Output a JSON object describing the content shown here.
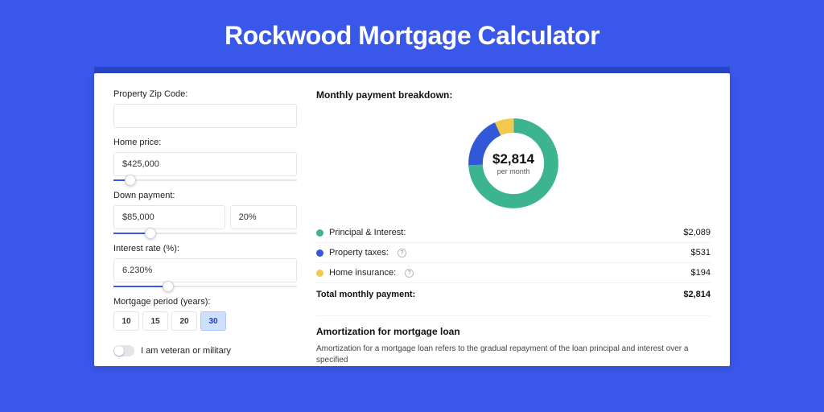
{
  "page_title": "Rockwood Mortgage Calculator",
  "colors": {
    "green": "#3cb490",
    "blue": "#3258d8",
    "yellow": "#f2c94c"
  },
  "form": {
    "zip_label": "Property Zip Code:",
    "zip_value": "",
    "home_price_label": "Home price:",
    "home_price_value": "$425,000",
    "home_price_slider_pct": 9,
    "down_payment_label": "Down payment:",
    "down_payment_value": "$85,000",
    "down_payment_pct_value": "20%",
    "down_payment_slider_pct": 20,
    "interest_label": "Interest rate (%):",
    "interest_value": "6.230%",
    "interest_slider_pct": 30,
    "period_label": "Mortgage period (years):",
    "periods": [
      "10",
      "15",
      "20",
      "30"
    ],
    "period_active_index": 3,
    "veteran_label": "I am veteran or military"
  },
  "breakdown": {
    "title": "Monthly payment breakdown:",
    "center_amount": "$2,814",
    "center_sub": "per month",
    "items": [
      {
        "label": "Principal & Interest:",
        "value": "$2,089",
        "color": "#3cb490",
        "info": false
      },
      {
        "label": "Property taxes:",
        "value": "$531",
        "color": "#3258d8",
        "info": true
      },
      {
        "label": "Home insurance:",
        "value": "$194",
        "color": "#f2c94c",
        "info": true
      }
    ],
    "total_label": "Total monthly payment:",
    "total_value": "$2,814"
  },
  "chart_data": {
    "type": "pie",
    "title": "Monthly payment breakdown",
    "series": [
      {
        "name": "Principal & Interest",
        "value": 2089,
        "color": "#3cb490"
      },
      {
        "name": "Property taxes",
        "value": 531,
        "color": "#3258d8"
      },
      {
        "name": "Home insurance",
        "value": 194,
        "color": "#f2c94c"
      }
    ],
    "total": 2814
  },
  "amortization": {
    "title": "Amortization for mortgage loan",
    "text": "Amortization for a mortgage loan refers to the gradual repayment of the loan principal and interest over a specified"
  }
}
